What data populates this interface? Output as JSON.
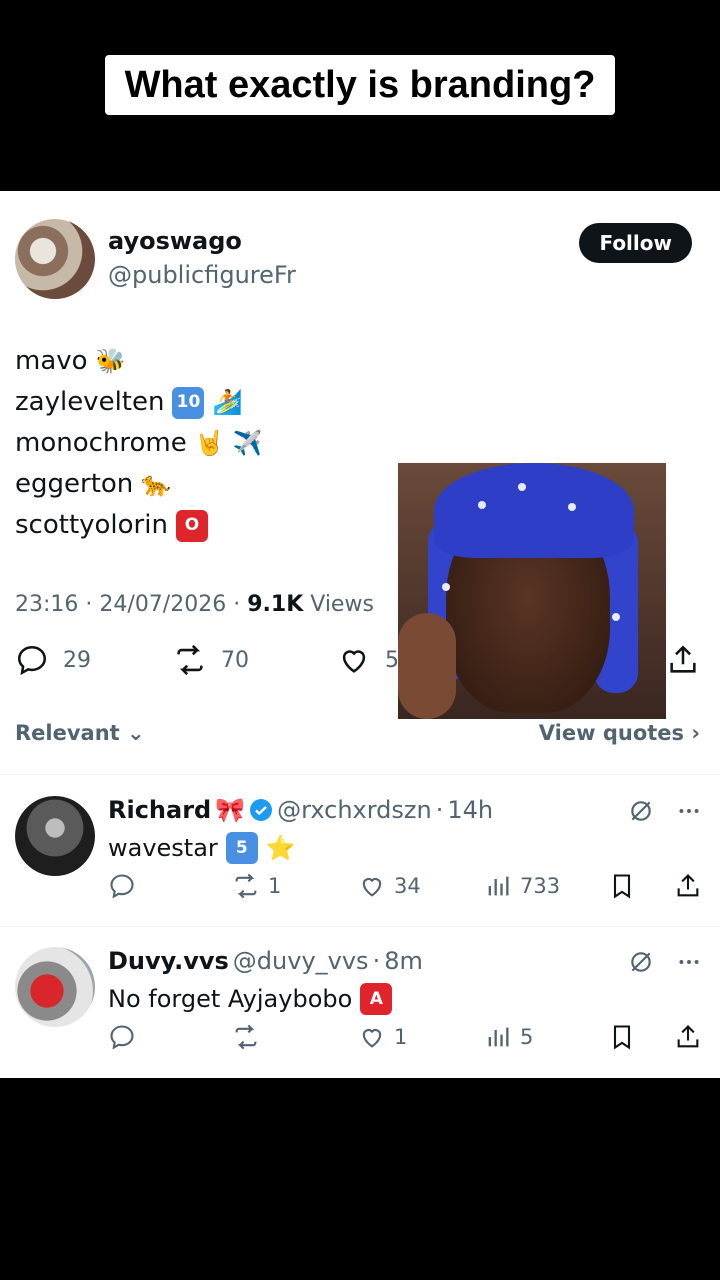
{
  "caption": "What exactly is branding?",
  "tweet": {
    "author_name": "ayoswago",
    "author_handle": "@publicfigureFr",
    "follow_label": "Follow",
    "lines": [
      {
        "text": "mavo",
        "emoji": "🐝"
      },
      {
        "text": "zaylevelten",
        "badge": "10",
        "emoji": "🏄"
      },
      {
        "text": "monochrome",
        "emoji": "🤘",
        "emoji2": "✈️"
      },
      {
        "text": "eggerton",
        "emoji": "🐆"
      },
      {
        "text": "scottyolorin",
        "badge": "O"
      }
    ],
    "time": "23:16",
    "date": "24/07/2026",
    "views_count": "9.1K",
    "views_label": "Views",
    "replies": "29",
    "reposts": "70",
    "likes": "56"
  },
  "filter": {
    "sort_label": "Relevant",
    "view_quotes_label": "View quotes"
  },
  "replies": [
    {
      "name": "Richard",
      "name_emoji": "🎀",
      "verified": true,
      "handle": "@rxchxrdszn",
      "time": "14h",
      "text": "wavestar",
      "badge": "5",
      "emoji": "⭐",
      "replies": "",
      "reposts": "1",
      "likes": "34",
      "views": "733"
    },
    {
      "name": "Duvy.vvs",
      "verified": false,
      "handle": "@duvy_vvs",
      "time": "8m",
      "text": "No forget  Ayjaybobo",
      "badge": "A",
      "replies": "",
      "reposts": "",
      "likes": "1",
      "views": "5"
    }
  ],
  "colors": {
    "text": "#0f1419",
    "muted": "#536471",
    "verified": "#1d9bf0",
    "badge_blue": "#4a90e2",
    "badge_red": "#e0242b"
  }
}
